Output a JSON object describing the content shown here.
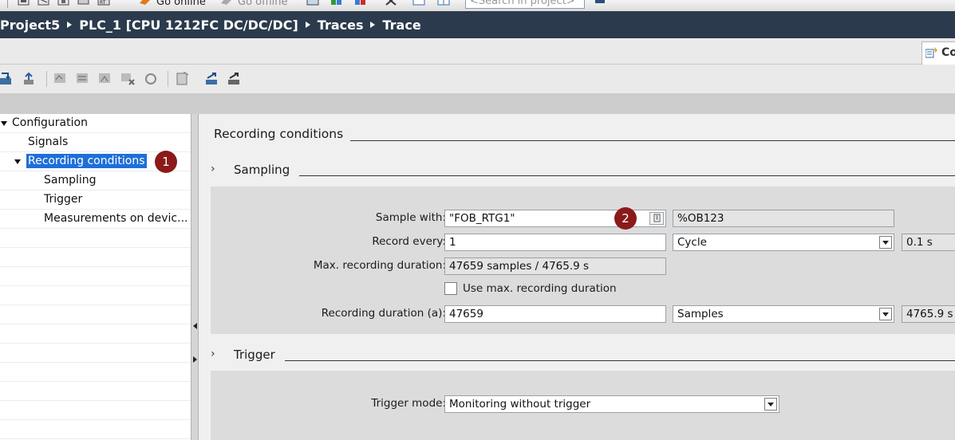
{
  "toolbar": {
    "go_online": "Go online",
    "go_offline": "Go offline",
    "search_placeholder": "<Search in project>"
  },
  "breadcrumb": [
    "Project5",
    "PLC_1 [CPU 1212FC DC/DC/DC]",
    "Traces",
    "Trace"
  ],
  "tab": {
    "label": "Co"
  },
  "tree": {
    "configuration": "Configuration",
    "signals": "Signals",
    "recording_conditions": "Recording conditions",
    "sampling": "Sampling",
    "trigger": "Trigger",
    "measurements": "Measurements on devic..."
  },
  "markers": {
    "one": "1",
    "two": "2"
  },
  "content": {
    "heading": "Recording conditions",
    "sampling": {
      "heading": "Sampling",
      "sample_with_label": "Sample with:",
      "sample_with_value": "\"FOB_RTG1\"",
      "sample_with_address": "%OB123",
      "record_every_label": "Record every:",
      "record_every_value": "1",
      "record_every_unit": "Cycle",
      "record_every_time": "0.1 s",
      "max_duration_label": "Max. recording duration:",
      "max_duration_value": "47659 samples / 4765.9 s",
      "use_max_label": "Use max. recording duration",
      "use_max_checked": false,
      "duration_label": "Recording duration (a):",
      "duration_value": "47659",
      "duration_unit": "Samples",
      "duration_time": "4765.9 s"
    },
    "trigger": {
      "heading": "Trigger",
      "mode_label": "Trigger mode:",
      "mode_value": "Monitoring without trigger"
    }
  },
  "colors": {
    "breadcrumb_bg": "#2b3a4c",
    "selection": "#1e6fd9",
    "marker": "#8b1a1a"
  }
}
